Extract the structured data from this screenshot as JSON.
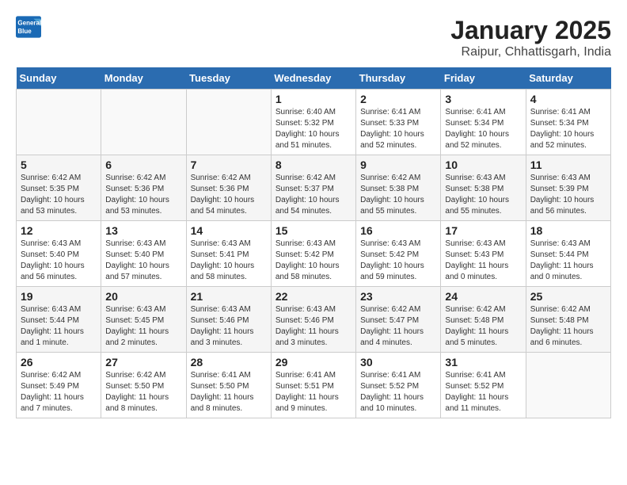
{
  "header": {
    "logo_line1": "General",
    "logo_line2": "Blue",
    "title": "January 2025",
    "subtitle": "Raipur, Chhattisgarh, India"
  },
  "days_of_week": [
    "Sunday",
    "Monday",
    "Tuesday",
    "Wednesday",
    "Thursday",
    "Friday",
    "Saturday"
  ],
  "weeks": [
    [
      {
        "day": "",
        "detail": ""
      },
      {
        "day": "",
        "detail": ""
      },
      {
        "day": "",
        "detail": ""
      },
      {
        "day": "1",
        "detail": "Sunrise: 6:40 AM\nSunset: 5:32 PM\nDaylight: 10 hours\nand 51 minutes."
      },
      {
        "day": "2",
        "detail": "Sunrise: 6:41 AM\nSunset: 5:33 PM\nDaylight: 10 hours\nand 52 minutes."
      },
      {
        "day": "3",
        "detail": "Sunrise: 6:41 AM\nSunset: 5:34 PM\nDaylight: 10 hours\nand 52 minutes."
      },
      {
        "day": "4",
        "detail": "Sunrise: 6:41 AM\nSunset: 5:34 PM\nDaylight: 10 hours\nand 52 minutes."
      }
    ],
    [
      {
        "day": "5",
        "detail": "Sunrise: 6:42 AM\nSunset: 5:35 PM\nDaylight: 10 hours\nand 53 minutes."
      },
      {
        "day": "6",
        "detail": "Sunrise: 6:42 AM\nSunset: 5:36 PM\nDaylight: 10 hours\nand 53 minutes."
      },
      {
        "day": "7",
        "detail": "Sunrise: 6:42 AM\nSunset: 5:36 PM\nDaylight: 10 hours\nand 54 minutes."
      },
      {
        "day": "8",
        "detail": "Sunrise: 6:42 AM\nSunset: 5:37 PM\nDaylight: 10 hours\nand 54 minutes."
      },
      {
        "day": "9",
        "detail": "Sunrise: 6:42 AM\nSunset: 5:38 PM\nDaylight: 10 hours\nand 55 minutes."
      },
      {
        "day": "10",
        "detail": "Sunrise: 6:43 AM\nSunset: 5:38 PM\nDaylight: 10 hours\nand 55 minutes."
      },
      {
        "day": "11",
        "detail": "Sunrise: 6:43 AM\nSunset: 5:39 PM\nDaylight: 10 hours\nand 56 minutes."
      }
    ],
    [
      {
        "day": "12",
        "detail": "Sunrise: 6:43 AM\nSunset: 5:40 PM\nDaylight: 10 hours\nand 56 minutes."
      },
      {
        "day": "13",
        "detail": "Sunrise: 6:43 AM\nSunset: 5:40 PM\nDaylight: 10 hours\nand 57 minutes."
      },
      {
        "day": "14",
        "detail": "Sunrise: 6:43 AM\nSunset: 5:41 PM\nDaylight: 10 hours\nand 58 minutes."
      },
      {
        "day": "15",
        "detail": "Sunrise: 6:43 AM\nSunset: 5:42 PM\nDaylight: 10 hours\nand 58 minutes."
      },
      {
        "day": "16",
        "detail": "Sunrise: 6:43 AM\nSunset: 5:42 PM\nDaylight: 10 hours\nand 59 minutes."
      },
      {
        "day": "17",
        "detail": "Sunrise: 6:43 AM\nSunset: 5:43 PM\nDaylight: 11 hours\nand 0 minutes."
      },
      {
        "day": "18",
        "detail": "Sunrise: 6:43 AM\nSunset: 5:44 PM\nDaylight: 11 hours\nand 0 minutes."
      }
    ],
    [
      {
        "day": "19",
        "detail": "Sunrise: 6:43 AM\nSunset: 5:44 PM\nDaylight: 11 hours\nand 1 minute."
      },
      {
        "day": "20",
        "detail": "Sunrise: 6:43 AM\nSunset: 5:45 PM\nDaylight: 11 hours\nand 2 minutes."
      },
      {
        "day": "21",
        "detail": "Sunrise: 6:43 AM\nSunset: 5:46 PM\nDaylight: 11 hours\nand 3 minutes."
      },
      {
        "day": "22",
        "detail": "Sunrise: 6:43 AM\nSunset: 5:46 PM\nDaylight: 11 hours\nand 3 minutes."
      },
      {
        "day": "23",
        "detail": "Sunrise: 6:42 AM\nSunset: 5:47 PM\nDaylight: 11 hours\nand 4 minutes."
      },
      {
        "day": "24",
        "detail": "Sunrise: 6:42 AM\nSunset: 5:48 PM\nDaylight: 11 hours\nand 5 minutes."
      },
      {
        "day": "25",
        "detail": "Sunrise: 6:42 AM\nSunset: 5:48 PM\nDaylight: 11 hours\nand 6 minutes."
      }
    ],
    [
      {
        "day": "26",
        "detail": "Sunrise: 6:42 AM\nSunset: 5:49 PM\nDaylight: 11 hours\nand 7 minutes."
      },
      {
        "day": "27",
        "detail": "Sunrise: 6:42 AM\nSunset: 5:50 PM\nDaylight: 11 hours\nand 8 minutes."
      },
      {
        "day": "28",
        "detail": "Sunrise: 6:41 AM\nSunset: 5:50 PM\nDaylight: 11 hours\nand 8 minutes."
      },
      {
        "day": "29",
        "detail": "Sunrise: 6:41 AM\nSunset: 5:51 PM\nDaylight: 11 hours\nand 9 minutes."
      },
      {
        "day": "30",
        "detail": "Sunrise: 6:41 AM\nSunset: 5:52 PM\nDaylight: 11 hours\nand 10 minutes."
      },
      {
        "day": "31",
        "detail": "Sunrise: 6:41 AM\nSunset: 5:52 PM\nDaylight: 11 hours\nand 11 minutes."
      },
      {
        "day": "",
        "detail": ""
      }
    ]
  ]
}
